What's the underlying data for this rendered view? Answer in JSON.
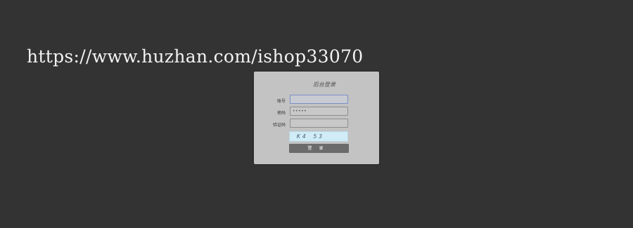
{
  "watermark": {
    "text": "https://www.huzhan.com/ishop33070"
  },
  "login": {
    "title": "后台登录",
    "fields": [
      {
        "label": "账号",
        "value": "",
        "placeholder": ""
      },
      {
        "label": "密码",
        "value": "•••••",
        "placeholder": ""
      },
      {
        "label": "验证码",
        "value": "",
        "placeholder": ""
      }
    ],
    "captcha_text": "K4 53",
    "submit_label": "登录"
  },
  "colors": {
    "background": "#333333",
    "panel": "#c3c3c3",
    "captcha_bg": "#d0ecf6",
    "button": "#6b6b6b",
    "focus_border": "#7a8fc9"
  }
}
